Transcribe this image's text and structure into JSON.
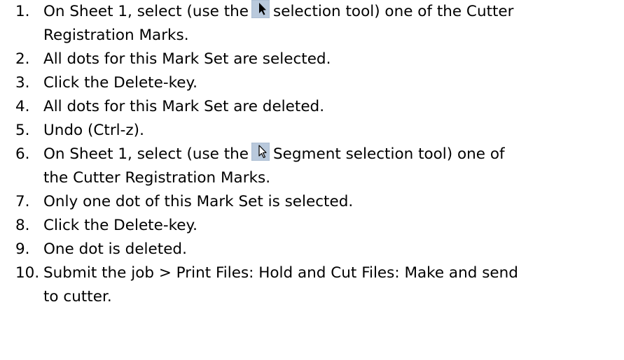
{
  "steps": [
    {
      "number": "1.",
      "before_icon": "On Sheet 1, select (use the",
      "icon": "selection-tool-icon",
      "after_icon": "selection tool) one of the Cutter",
      "continuation": "Registration Marks."
    },
    {
      "number": "2.",
      "text": "All dots for this Mark Set are selected."
    },
    {
      "number": "3.",
      "text": "Click the Delete-key."
    },
    {
      "number": "4.",
      "text": "All dots for this Mark Set are deleted."
    },
    {
      "number": "5.",
      "text": "Undo (Ctrl-z)."
    },
    {
      "number": "6.",
      "before_icon": "On Sheet 1, select (use the",
      "icon": "segment-selection-tool-icon",
      "after_icon": "Segment selection tool) one of",
      "continuation": "the Cutter Registration Marks."
    },
    {
      "number": "7.",
      "text": "Only one dot of this Mark Set is selected."
    },
    {
      "number": "8.",
      "text": "Click the Delete-key."
    },
    {
      "number": "9.",
      "text": "One dot is deleted."
    },
    {
      "number": "10.",
      "text": "Submit the job > Print Files: Hold and Cut Files: Make and send",
      "continuation": "to cutter."
    }
  ],
  "colors": {
    "text": "#000000",
    "icon_background": "#b9c9dc",
    "selection_arrow": "#000000",
    "segment_arrow": "#ffffff"
  }
}
